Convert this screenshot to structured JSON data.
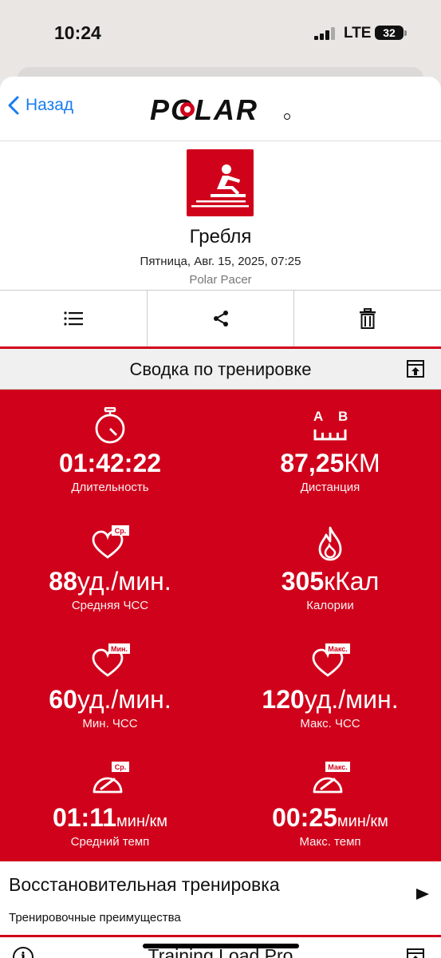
{
  "status": {
    "time": "10:24",
    "network": "LTE",
    "battery": "32"
  },
  "nav": {
    "back_label": "Назад"
  },
  "activity": {
    "sport": "Гребля",
    "date": "Пятница, Авг. 15, 2025, 07:25",
    "device": "Polar Pacer"
  },
  "summary": {
    "title": "Сводка по тренировке"
  },
  "stats": {
    "duration": {
      "value": "01:42:22",
      "unit": "",
      "label": "Длительность"
    },
    "distance": {
      "value": "87,25",
      "unit": "КМ",
      "label": "Дистанция"
    },
    "avg_hr": {
      "value": "88",
      "unit": "уд./мин.",
      "label": "Средняя ЧСС",
      "badge": "Ср."
    },
    "calories": {
      "value": "305",
      "unit": "кКал",
      "label": "Калории"
    },
    "min_hr": {
      "value": "60",
      "unit": "уд./мин.",
      "label": "Мин. ЧСС",
      "badge": "Мин."
    },
    "max_hr": {
      "value": "120",
      "unit": "уд./мин.",
      "label": "Макс. ЧСС",
      "badge": "Макс."
    },
    "avg_pace": {
      "value": "01:11",
      "unit": "мин/км",
      "label": "Средний темп",
      "badge": "Ср."
    },
    "max_pace": {
      "value": "00:25",
      "unit": "мин/км",
      "label": "Макс. темп",
      "badge": "Макс."
    },
    "distance_icon_letters": {
      "a": "A",
      "b": "B"
    }
  },
  "recovery": {
    "title": "Восстановительная тренировка",
    "subtitle": "Тренировочные преимущества"
  },
  "training_load": {
    "title": "Training Load Pro",
    "info": "i"
  },
  "brand": {
    "logo": "POLAR",
    "accent": "#d0021b",
    "link": "#1a7cf0"
  },
  "icons": [
    "chevron-left-icon",
    "rowing-icon",
    "list-icon",
    "share-icon",
    "trash-icon",
    "stopwatch-icon",
    "distance-icon",
    "heart-icon",
    "flame-icon",
    "gauge-icon",
    "play-arrow-icon",
    "info-icon"
  ]
}
